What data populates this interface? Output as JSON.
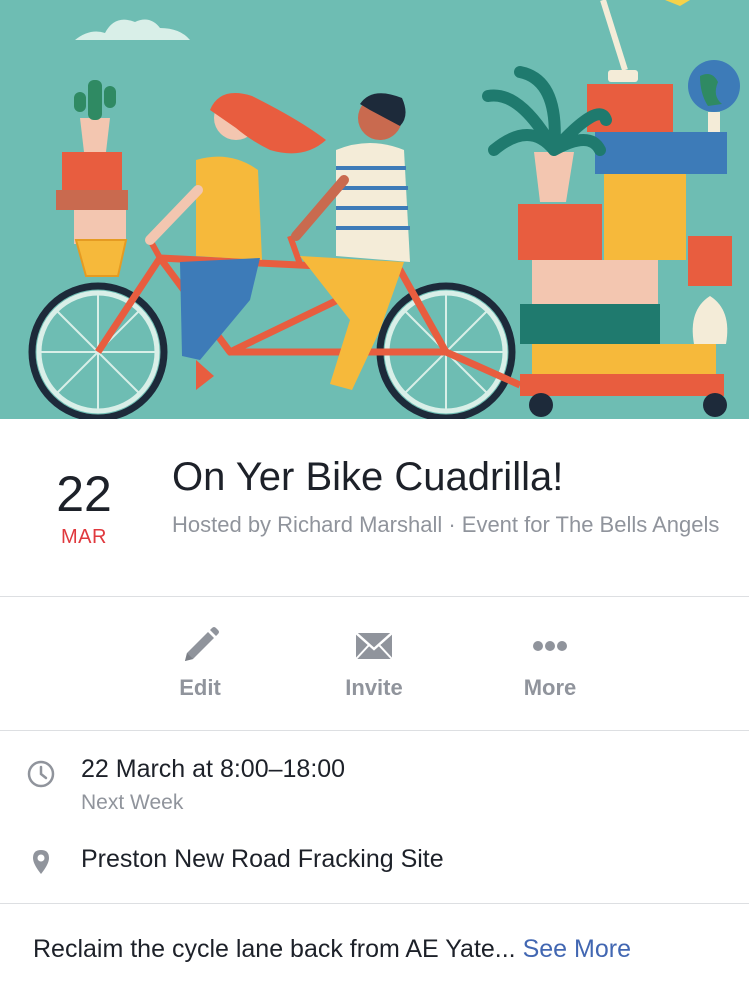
{
  "cover": {
    "image": "tandem-bicycle-illustration",
    "colors": {
      "sky": "#6ebdb3",
      "frame": "#e85d3f",
      "yellow": "#f6b93b"
    }
  },
  "event": {
    "date_day": "22",
    "date_month": "MAR",
    "title": "On Yer Bike Cuadrilla!",
    "hosted_by": "Hosted by Richard Marshall · Event for The Bells Angels"
  },
  "actions": [
    {
      "label": "Edit",
      "icon": "pencil-icon"
    },
    {
      "label": "Invite",
      "icon": "envelope-icon"
    },
    {
      "label": "More",
      "icon": "more-dots-icon"
    }
  ],
  "details": {
    "time": "22 March at 8:00–18:00",
    "time_relative": "Next Week",
    "location": "Preston New Road Fracking Site"
  },
  "description": {
    "text": "Reclaim the cycle lane back from AE Yate...",
    "see_more": "See More"
  },
  "colors": {
    "accent_red": "#e0393e",
    "link_blue": "#4267b2",
    "secondary_text": "#90949c",
    "divider": "#dddfe2"
  }
}
